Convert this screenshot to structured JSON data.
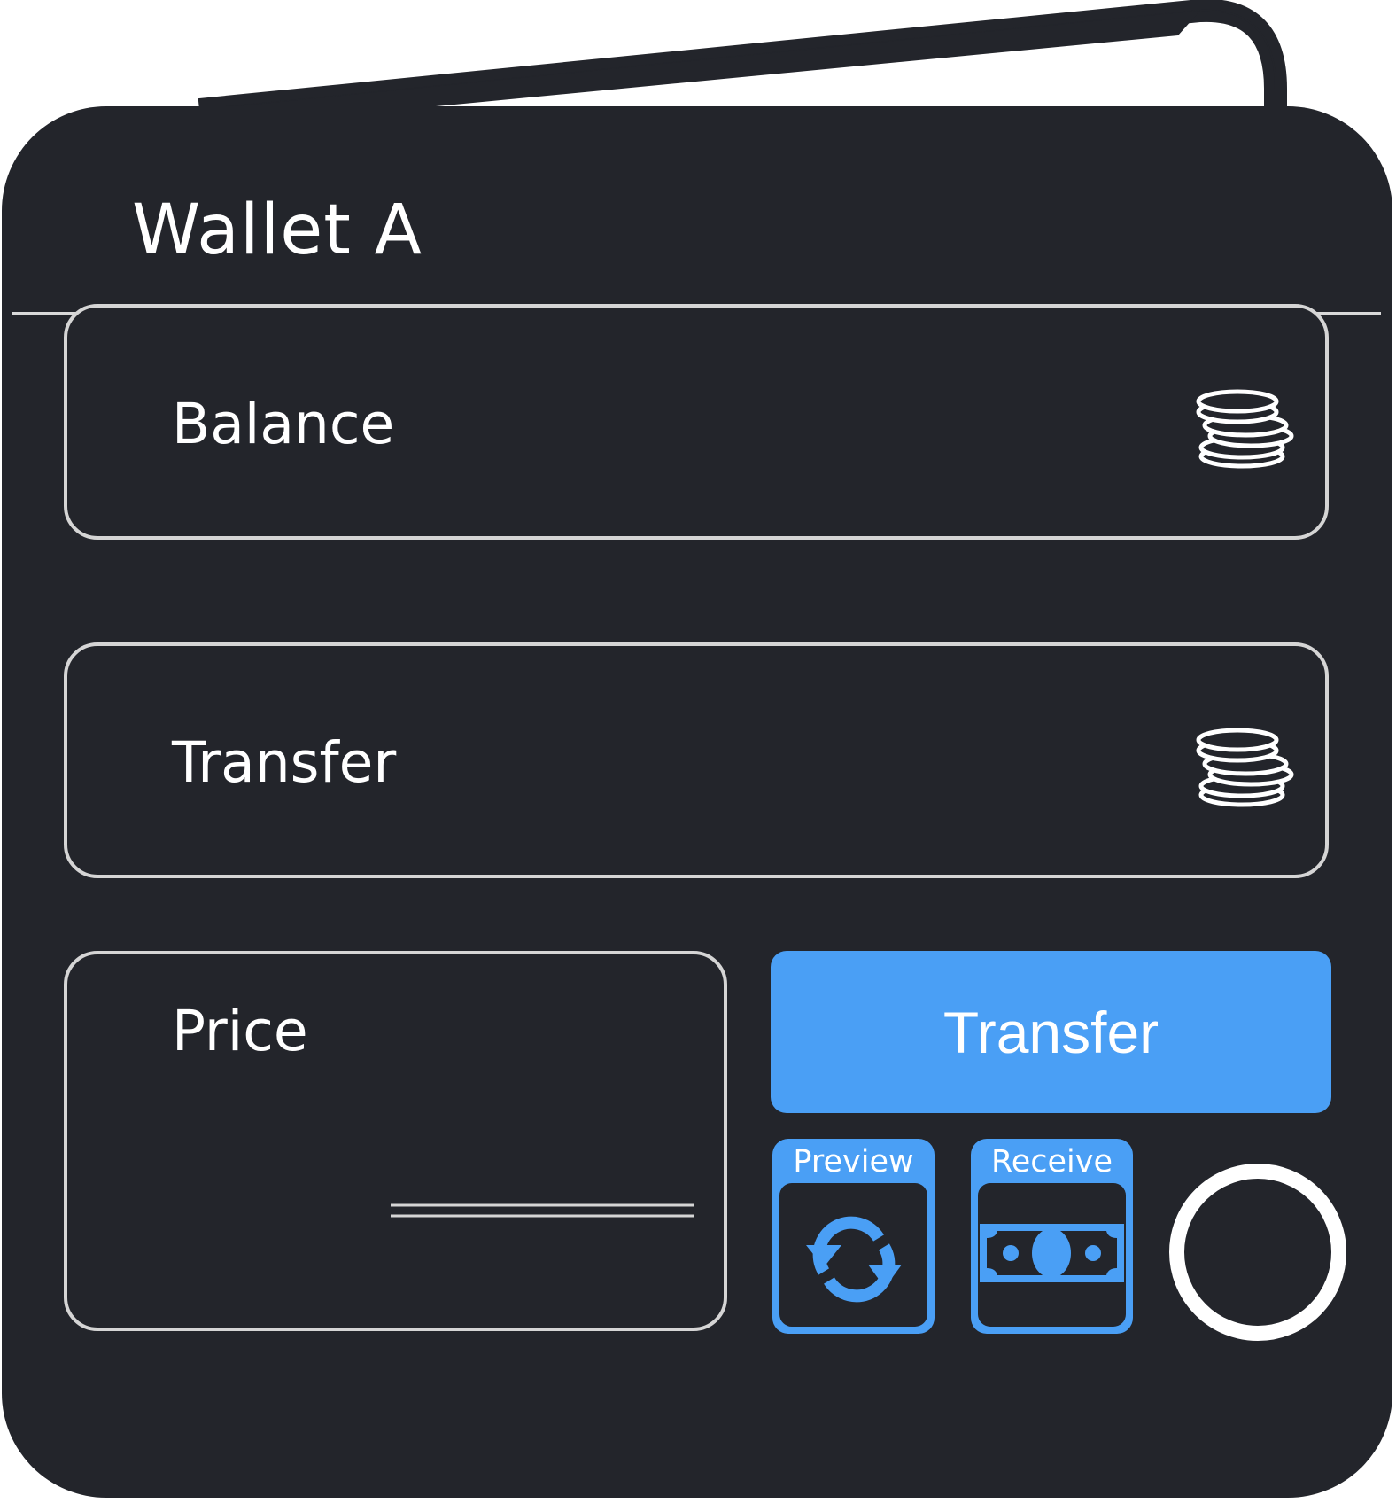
{
  "wallet": {
    "title": "Wallet A"
  },
  "fields": {
    "balance": {
      "label": "Balance",
      "icon": "coins-icon"
    },
    "transfer": {
      "label": "Transfer",
      "icon": "coins-icon"
    },
    "price": {
      "label": "Price"
    }
  },
  "actions": {
    "transfer_label": "Transfer",
    "preview_label": "Preview",
    "preview_icon": "refresh-icon",
    "receive_label": "Receive",
    "receive_icon": "banknote-icon",
    "round_button_icon": "circle-icon"
  },
  "colors": {
    "background": "#23252b",
    "accent": "#4a9ff5",
    "outline": "#d5d5d5",
    "text": "#ffffff"
  }
}
